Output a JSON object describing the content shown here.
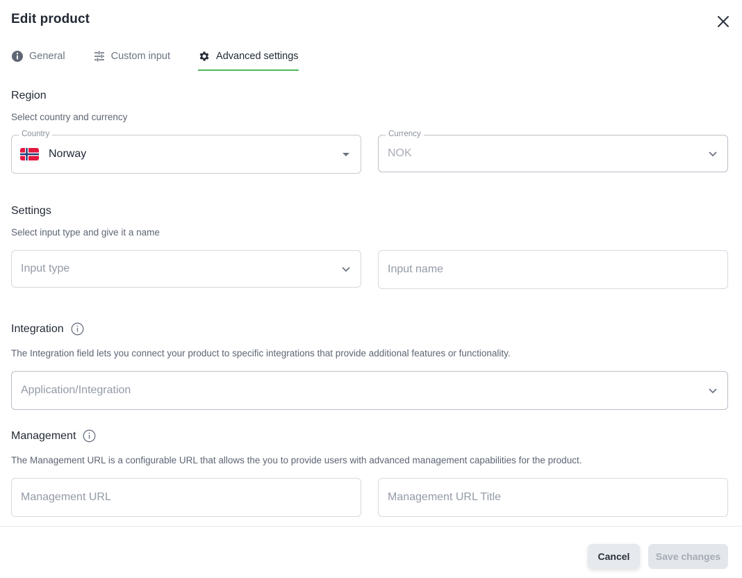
{
  "header": {
    "title": "Edit product",
    "close_icon": "close-icon"
  },
  "tabs": [
    {
      "label": "General",
      "icon": "info-icon",
      "active": false
    },
    {
      "label": "Custom input",
      "icon": "sliders-icon",
      "active": false
    },
    {
      "label": "Advanced settings",
      "icon": "gear-icon",
      "active": true
    }
  ],
  "region": {
    "title": "Region",
    "description": "Select country and currency",
    "country": {
      "label": "Country",
      "value": "Norway",
      "flag": "norway-flag"
    },
    "currency": {
      "label": "Currency",
      "value": "NOK"
    }
  },
  "settings": {
    "title": "Settings",
    "description": "Select input type and give it a name",
    "input_type_placeholder": "Input type",
    "input_name_placeholder": "Input name"
  },
  "integration": {
    "title": "Integration",
    "description": "The Integration field lets you connect your product to specific integrations that provide additional features or functionality.",
    "placeholder": "Application/Integration"
  },
  "management": {
    "title": "Management",
    "description": "The Management URL is a configurable URL that allows the you to provide users with advanced management capabilities for the product.",
    "url_placeholder": "Management URL",
    "url_title_placeholder": "Management URL Title"
  },
  "footer": {
    "cancel_label": "Cancel",
    "save_label": "Save changes"
  },
  "colors": {
    "accent": "#4cb85a",
    "text": "#232a35",
    "muted": "#5d6573"
  }
}
